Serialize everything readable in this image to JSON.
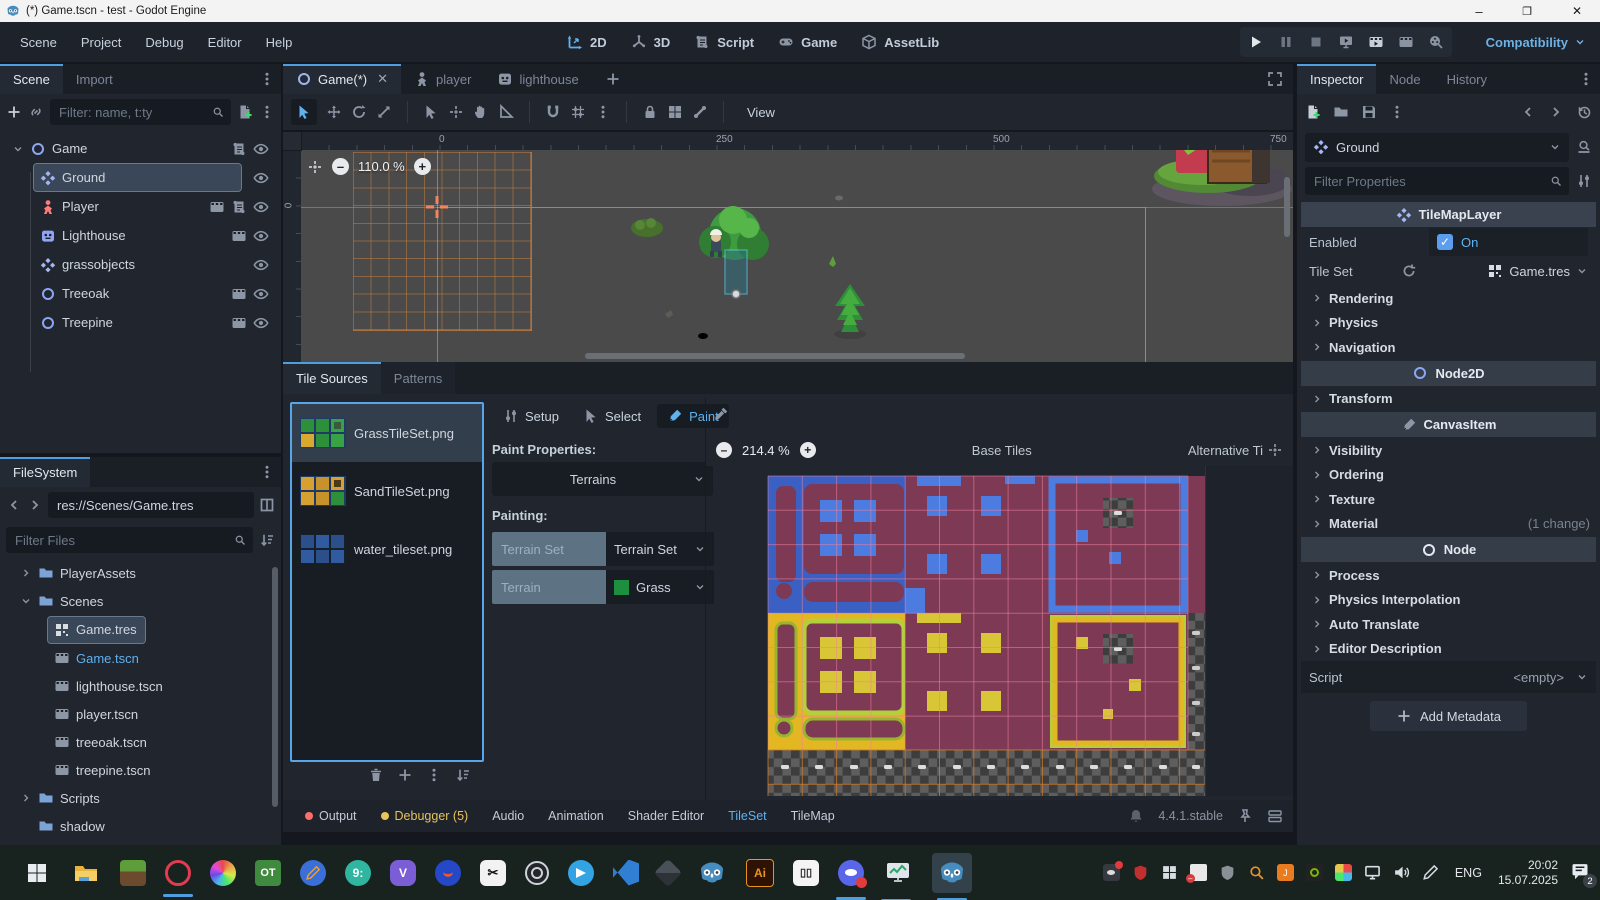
{
  "window": {
    "title": "(*) Game.tscn - test - Godot Engine"
  },
  "menubar": {
    "items": [
      "Scene",
      "Project",
      "Debug",
      "Editor",
      "Help"
    ],
    "workspaces": [
      "2D",
      "3D",
      "Script",
      "Game",
      "AssetLib"
    ],
    "active_workspace": "2D",
    "renderer": "Compatibility"
  },
  "playback": {
    "buttons": [
      "play",
      "pause",
      "stop",
      "remote-debug",
      "play-scene",
      "play-custom-scene",
      "movie-maker"
    ]
  },
  "scene_dock": {
    "tabs": [
      "Scene",
      "Import"
    ],
    "filter_placeholder": "Filter: name, t:ty",
    "nodes": [
      "Game",
      "Ground",
      "Player",
      "Lighthouse",
      "grassobjects",
      "Treeoak",
      "Treepine"
    ]
  },
  "filesystem": {
    "title": "FileSystem",
    "path": "res://Scenes/Game.tres",
    "filter_placeholder": "Filter Files",
    "items": [
      "PlayerAssets",
      "Scenes",
      "Game.tres",
      "Game.tscn",
      "lighthouse.tscn",
      "player.tscn",
      "treeoak.tscn",
      "treepine.tscn",
      "Scripts",
      "shadow"
    ]
  },
  "viewport": {
    "tabs": [
      "Game(*)",
      "player",
      "lighthouse"
    ],
    "zoom": "110.0 %",
    "view_menu": "View",
    "ruler_ticks": [
      "0",
      "250",
      "500",
      "750"
    ],
    "vertical_ruler_tick": "0"
  },
  "tileset": {
    "tabs": [
      "Tile Sources",
      "Patterns"
    ],
    "sources": [
      "GrassTileSet.png",
      "SandTileSet.png",
      "water_tileset.png"
    ],
    "modes": [
      "Setup",
      "Select",
      "Paint"
    ],
    "active_mode": "Paint",
    "paint_properties_label": "Paint Properties:",
    "paint_tool": "Terrains",
    "painting_label": "Painting:",
    "terrain_set_label": "Terrain Set",
    "terrain_set_value": "Terrain Set",
    "terrain_label": "Terrain",
    "terrain_value": "Grass",
    "terrain_color": "#1e8f3e",
    "zoom": "214.4 %",
    "base_tiles_label": "Base Tiles",
    "alternative_tiles_label": "Alternative Ti",
    "list_actions": [
      "delete",
      "add",
      "menu",
      "sort"
    ]
  },
  "statusbar": {
    "tabs": [
      "Output",
      "Debugger (5)",
      "Audio",
      "Animation",
      "Shader Editor",
      "TileSet",
      "TileMap"
    ],
    "active_tab": "TileSet",
    "version": "4.4.1.stable"
  },
  "inspector": {
    "tabs": [
      "Inspector",
      "Node",
      "History"
    ],
    "node_name": "Ground",
    "doc_label": "DOC",
    "filter_placeholder": "Filter Properties",
    "class_name": "TileMapLayer",
    "enabled_label": "Enabled",
    "enabled_value": "On",
    "tileset_label": "Tile Set",
    "tileset_value": "Game.tres",
    "sections_tilemap": [
      "Rendering",
      "Physics",
      "Navigation"
    ],
    "category_node2d": "Node2D",
    "section_transform": "Transform",
    "category_canvasitem": "CanvasItem",
    "sections_canvasitem": [
      "Visibility",
      "Ordering",
      "Texture",
      "Material"
    ],
    "material_note": "(1 change)",
    "category_node": "Node",
    "sections_node": [
      "Process",
      "Physics Interpolation",
      "Auto Translate",
      "Editor Description"
    ],
    "script_label": "Script",
    "script_value": "<empty>",
    "add_metadata_label": "Add Metadata"
  },
  "taskbar": {
    "apps": [
      "windows-start",
      "file-explorer",
      "minecraft",
      "opera-gx",
      "color-wheel",
      "opentoonz",
      "pencil-tool",
      "goodnotes",
      "viber",
      "voicemod",
      "capcut",
      "obs-studio",
      "telegram",
      "vscode",
      "inkscape",
      "godot",
      "illustrator",
      "aseprite",
      "discord",
      "performance-monitor",
      "godot-editor"
    ],
    "tray": [
      "discord",
      "security-alert",
      "widgets",
      "defender",
      "shield",
      "everything-search",
      "java",
      "nvidia",
      "avg",
      "display",
      "volume",
      "pen"
    ],
    "language": "ENG",
    "time": "20:02",
    "date": "15.07.2025",
    "notification_badge": "2"
  }
}
